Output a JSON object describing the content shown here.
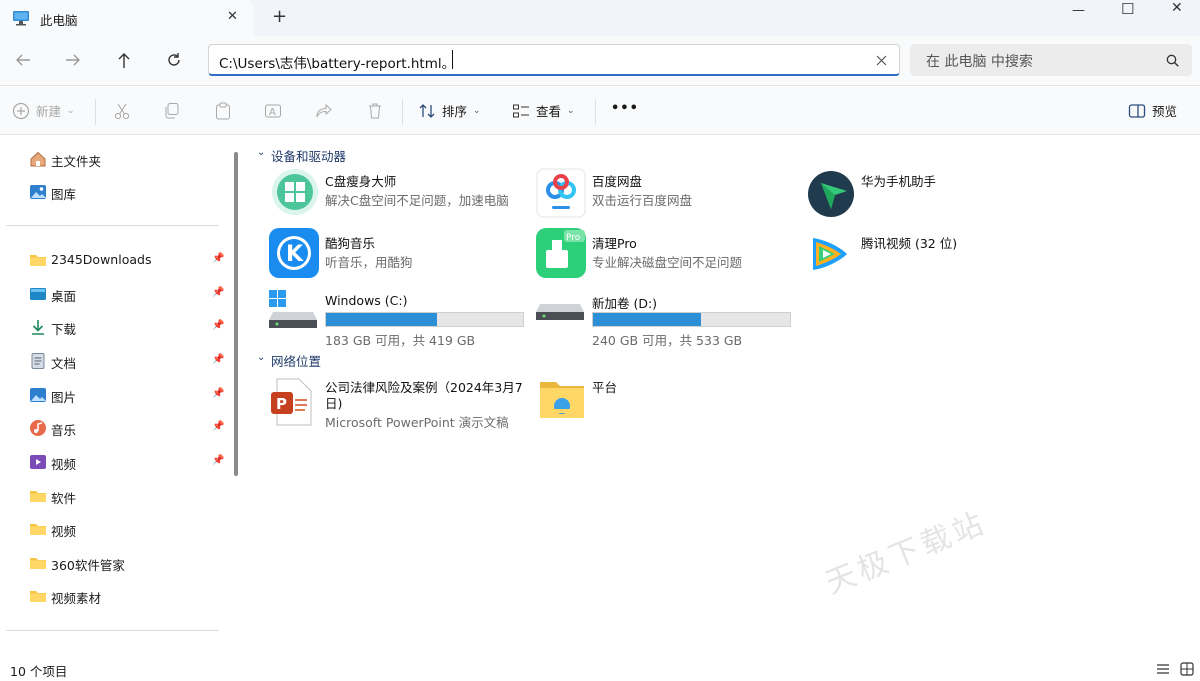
{
  "window": {
    "tab_title": "此电脑",
    "new_tab_label": "+",
    "close_tab_label": "✕",
    "controls": {
      "minimize": "—",
      "maximize": "☐",
      "close": "✕"
    }
  },
  "nav": {
    "address_value": "C:\\Users\\志伟\\battery-report.html。",
    "search_placeholder": "在 此电脑 中搜索"
  },
  "toolbar": {
    "new_label": "新建",
    "sort_label": "排序",
    "view_label": "查看",
    "more_label": "•••",
    "preview_label": "预览"
  },
  "sidebar": {
    "top_items": [
      {
        "label": "主文件夹",
        "icon": "home-icon"
      },
      {
        "label": "图库",
        "icon": "gallery-icon"
      }
    ],
    "pinned_items": [
      {
        "label": "2345Downloads",
        "icon": "folder-icon",
        "pinned": true
      },
      {
        "label": "桌面",
        "icon": "desktop-icon",
        "pinned": true
      },
      {
        "label": "下载",
        "icon": "download-icon",
        "pinned": true
      },
      {
        "label": "文档",
        "icon": "document-icon",
        "pinned": true
      },
      {
        "label": "图片",
        "icon": "pictures-icon",
        "pinned": true
      },
      {
        "label": "音乐",
        "icon": "music-icon",
        "pinned": true
      },
      {
        "label": "视频",
        "icon": "video-icon",
        "pinned": true
      },
      {
        "label": "软件",
        "icon": "folder-icon",
        "pinned": false
      },
      {
        "label": "视频",
        "icon": "folder-icon",
        "pinned": false
      },
      {
        "label": "360软件管家",
        "icon": "folder-icon",
        "pinned": false
      },
      {
        "label": "视频素材",
        "icon": "folder-icon",
        "pinned": false
      }
    ]
  },
  "main": {
    "devices_header": "设备和驱动器",
    "apps": [
      {
        "title": "C盘瘦身大师",
        "subtitle": "解决C盘空间不足问题，加速电脑",
        "icon": "c-drive-cleaner-icon"
      },
      {
        "title": "百度网盘",
        "subtitle": "双击运行百度网盘",
        "icon": "baidu-netdisk-icon"
      },
      {
        "title": "华为手机助手",
        "subtitle": "",
        "icon": "huawei-assistant-icon"
      },
      {
        "title": "酷狗音乐",
        "subtitle": "听音乐，用酷狗",
        "icon": "kugou-icon"
      },
      {
        "title": "清理Pro",
        "subtitle": "专业解决磁盘空间不足问题",
        "icon": "cleaner-pro-icon"
      },
      {
        "title": "腾讯视频 (32 位)",
        "subtitle": "",
        "icon": "tencent-video-icon"
      }
    ],
    "drives": [
      {
        "title": "Windows (C:)",
        "usage": "183 GB 可用，共 419 GB",
        "used_fraction": 0.563
      },
      {
        "title": "新加卷 (D:)",
        "usage": "240 GB 可用，共 533 GB",
        "used_fraction": 0.55
      }
    ],
    "network_header": "网络位置",
    "network": [
      {
        "title_line1": "公司法律风险及案例（2024年3月7",
        "title_line2": "日)",
        "subtitle": "Microsoft PowerPoint 演示文稿",
        "icon": "powerpoint-icon"
      },
      {
        "title_line1": "平台",
        "title_line2": "",
        "subtitle": "",
        "icon": "network-folder-icon"
      }
    ]
  },
  "status": {
    "item_count": "10 个项目"
  },
  "watermark": "天极下载站",
  "colors": {
    "accent": "#2f6ec4",
    "drive_fill": "#2d8fd5",
    "folder": "#f4c542"
  }
}
